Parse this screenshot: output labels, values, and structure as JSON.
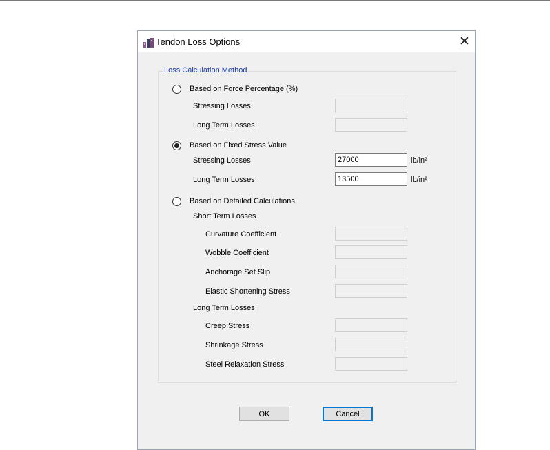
{
  "window": {
    "title": "Tendon Loss Options",
    "close_glyph": "✕",
    "icon": "app-icon"
  },
  "group": {
    "legend": "Loss Calculation Method"
  },
  "force_percentage": {
    "label": "Based on Force Percentage (%)",
    "selected": false,
    "stressing_label": "Stressing Losses",
    "stressing_value": "",
    "long_term_label": "Long Term Losses",
    "long_term_value": ""
  },
  "fixed_stress": {
    "label": "Based on Fixed Stress Value",
    "selected": true,
    "stressing_label": "Stressing Losses",
    "stressing_value": "27000",
    "stressing_unit": "lb/in²",
    "long_term_label": "Long Term Losses",
    "long_term_value": "13500",
    "long_term_unit": "lb/in²"
  },
  "detailed": {
    "label": "Based on Detailed Calculations",
    "selected": false,
    "short_term_header": "Short Term Losses",
    "curvature_label": "Curvature Coefficient",
    "curvature_value": "",
    "wobble_label": "Wobble Coefficient",
    "wobble_value": "",
    "anchorage_label": "Anchorage Set Slip",
    "anchorage_value": "",
    "elastic_label": "Elastic Shortening Stress",
    "elastic_value": "",
    "long_term_header": "Long Term Losses",
    "creep_label": "Creep Stress",
    "creep_value": "",
    "shrinkage_label": "Shrinkage Stress",
    "shrinkage_value": "",
    "relaxation_label": "Steel Relaxation Stress",
    "relaxation_value": ""
  },
  "buttons": {
    "ok": "OK",
    "cancel": "Cancel"
  }
}
